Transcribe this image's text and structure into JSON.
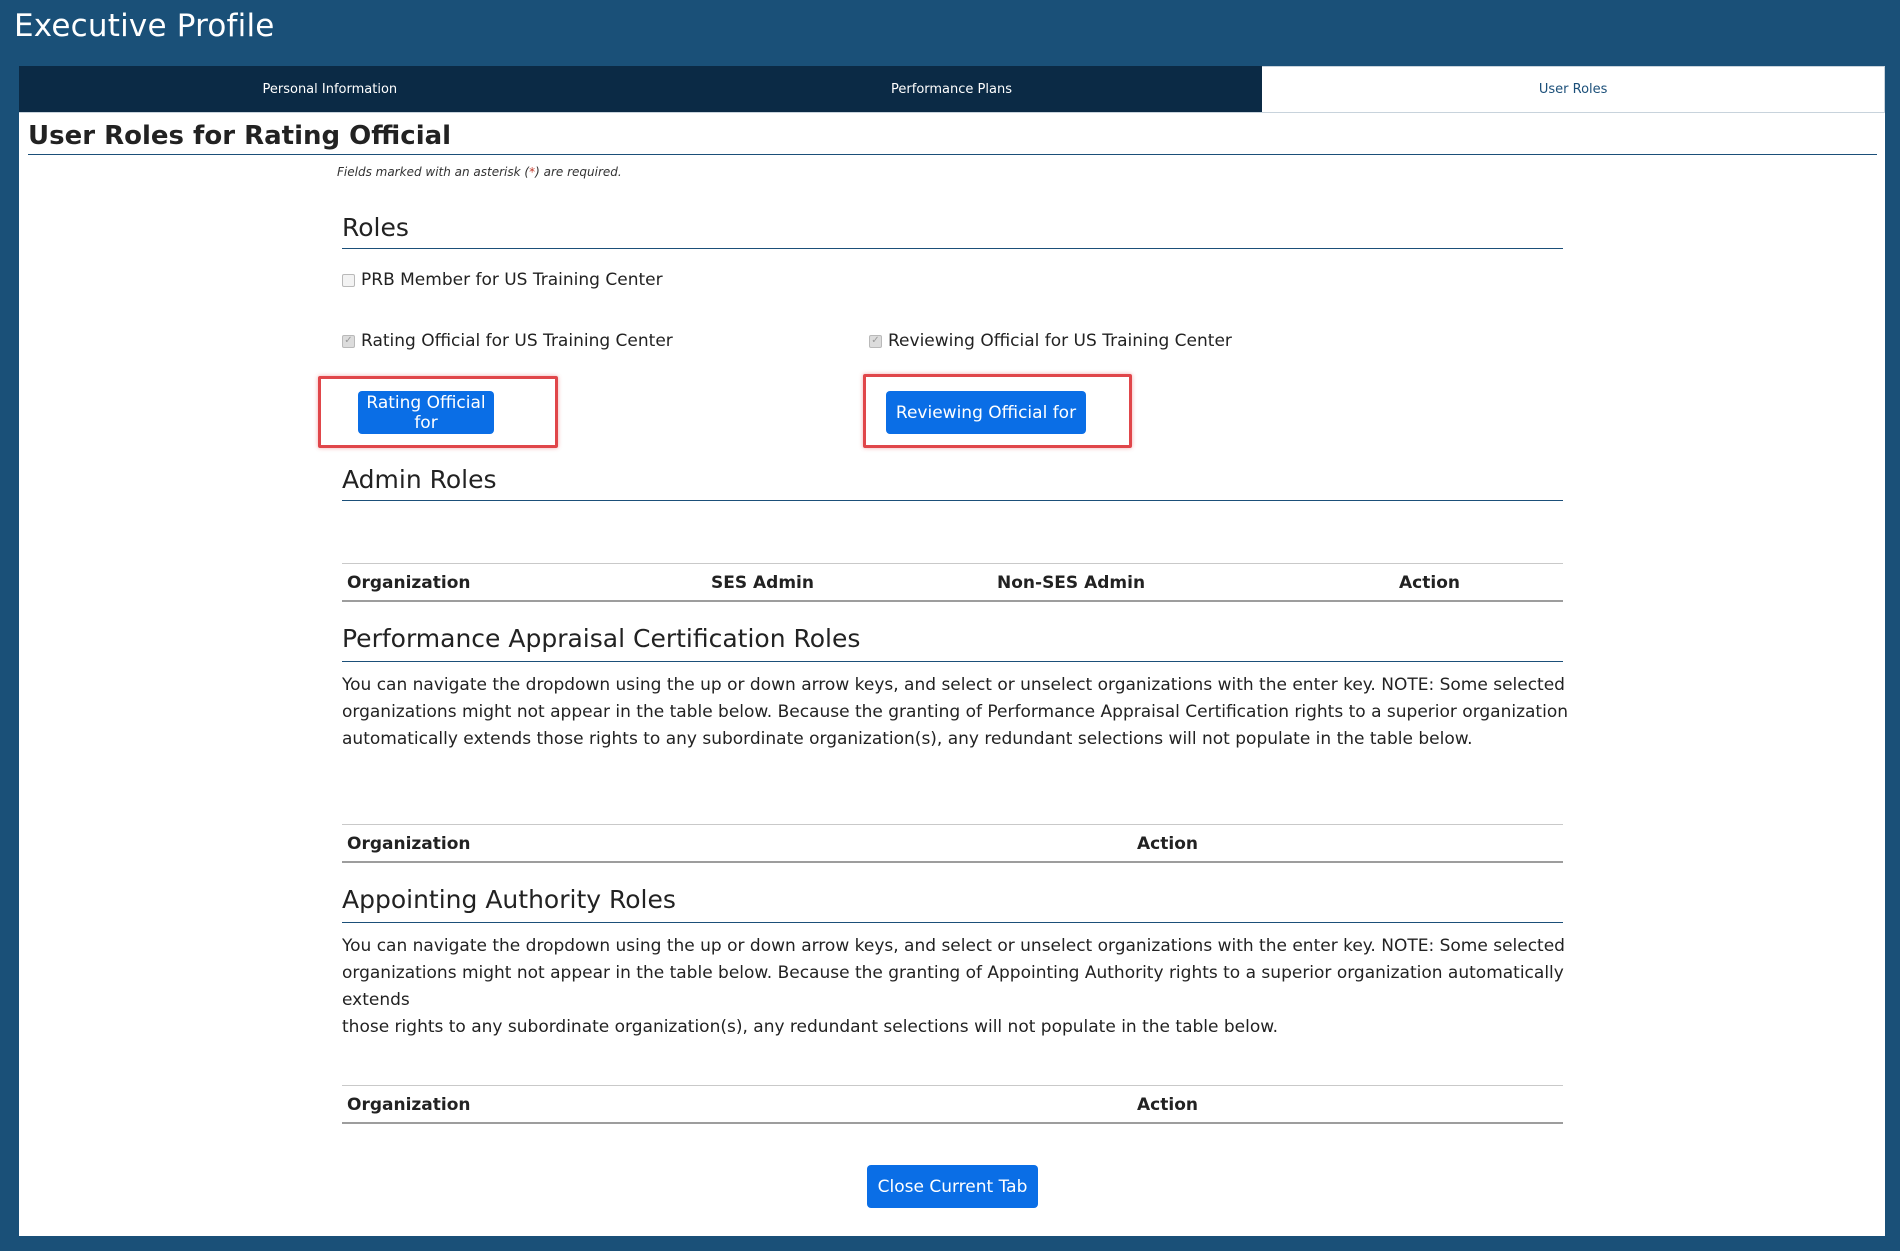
{
  "app": {
    "title": "Executive Profile"
  },
  "tabs": [
    {
      "label": "Personal Information",
      "active": false
    },
    {
      "label": "Performance Plans",
      "active": false
    },
    {
      "label": "User Roles",
      "active": true
    }
  ],
  "page": {
    "title": "User Roles for Rating Official",
    "required_note_prefix": "Fields marked with an asterisk (",
    "required_note_asterisk": "*",
    "required_note_suffix": ") are required."
  },
  "roles": {
    "heading": "Roles",
    "checkboxes": [
      {
        "label": "PRB Member for US Training Center",
        "checked": false
      },
      {
        "label": "Rating Official for US Training Center",
        "checked": true
      },
      {
        "label": "Reviewing Official for US Training Center",
        "checked": true
      }
    ],
    "buttons": {
      "rating_official": "Rating Official for",
      "reviewing_official": "Reviewing Official for"
    }
  },
  "admin_roles": {
    "heading": "Admin Roles",
    "columns": [
      "Organization",
      "SES Admin",
      "Non-SES Admin",
      "Action"
    ]
  },
  "pac_roles": {
    "heading": "Performance Appraisal Certification Roles",
    "description_lines": [
      "You can navigate the dropdown using the up or down arrow keys, and select or unselect organizations with the enter key. NOTE: Some selected",
      "organizations might not appear in the table below. Because the granting of Performance Appraisal Certification rights to a superior organization",
      "automatically extends those rights to any subordinate organization(s), any redundant selections will not populate in the table below."
    ],
    "columns": [
      "Organization",
      "Action"
    ]
  },
  "appointing_roles": {
    "heading": "Appointing Authority Roles",
    "description_lines": [
      "You can navigate the dropdown using the up or down arrow keys, and select or unselect organizations with the enter key. NOTE: Some selected",
      "organizations might not appear in the table below. Because the granting of Appointing Authority rights to a superior organization automatically extends",
      "those rights to any subordinate organization(s), any redundant selections will not populate in the table below."
    ],
    "columns": [
      "Organization",
      "Action"
    ]
  },
  "footer": {
    "close_button": "Close Current Tab"
  },
  "colors": {
    "page_background": "#1a5078",
    "tab_bar": "#0b2a45",
    "primary_button": "#0a6ee6",
    "highlight_box": "#e0464a",
    "rule": "#1b4f79"
  },
  "icons": {
    "checkbox_checked": "check-icon"
  }
}
